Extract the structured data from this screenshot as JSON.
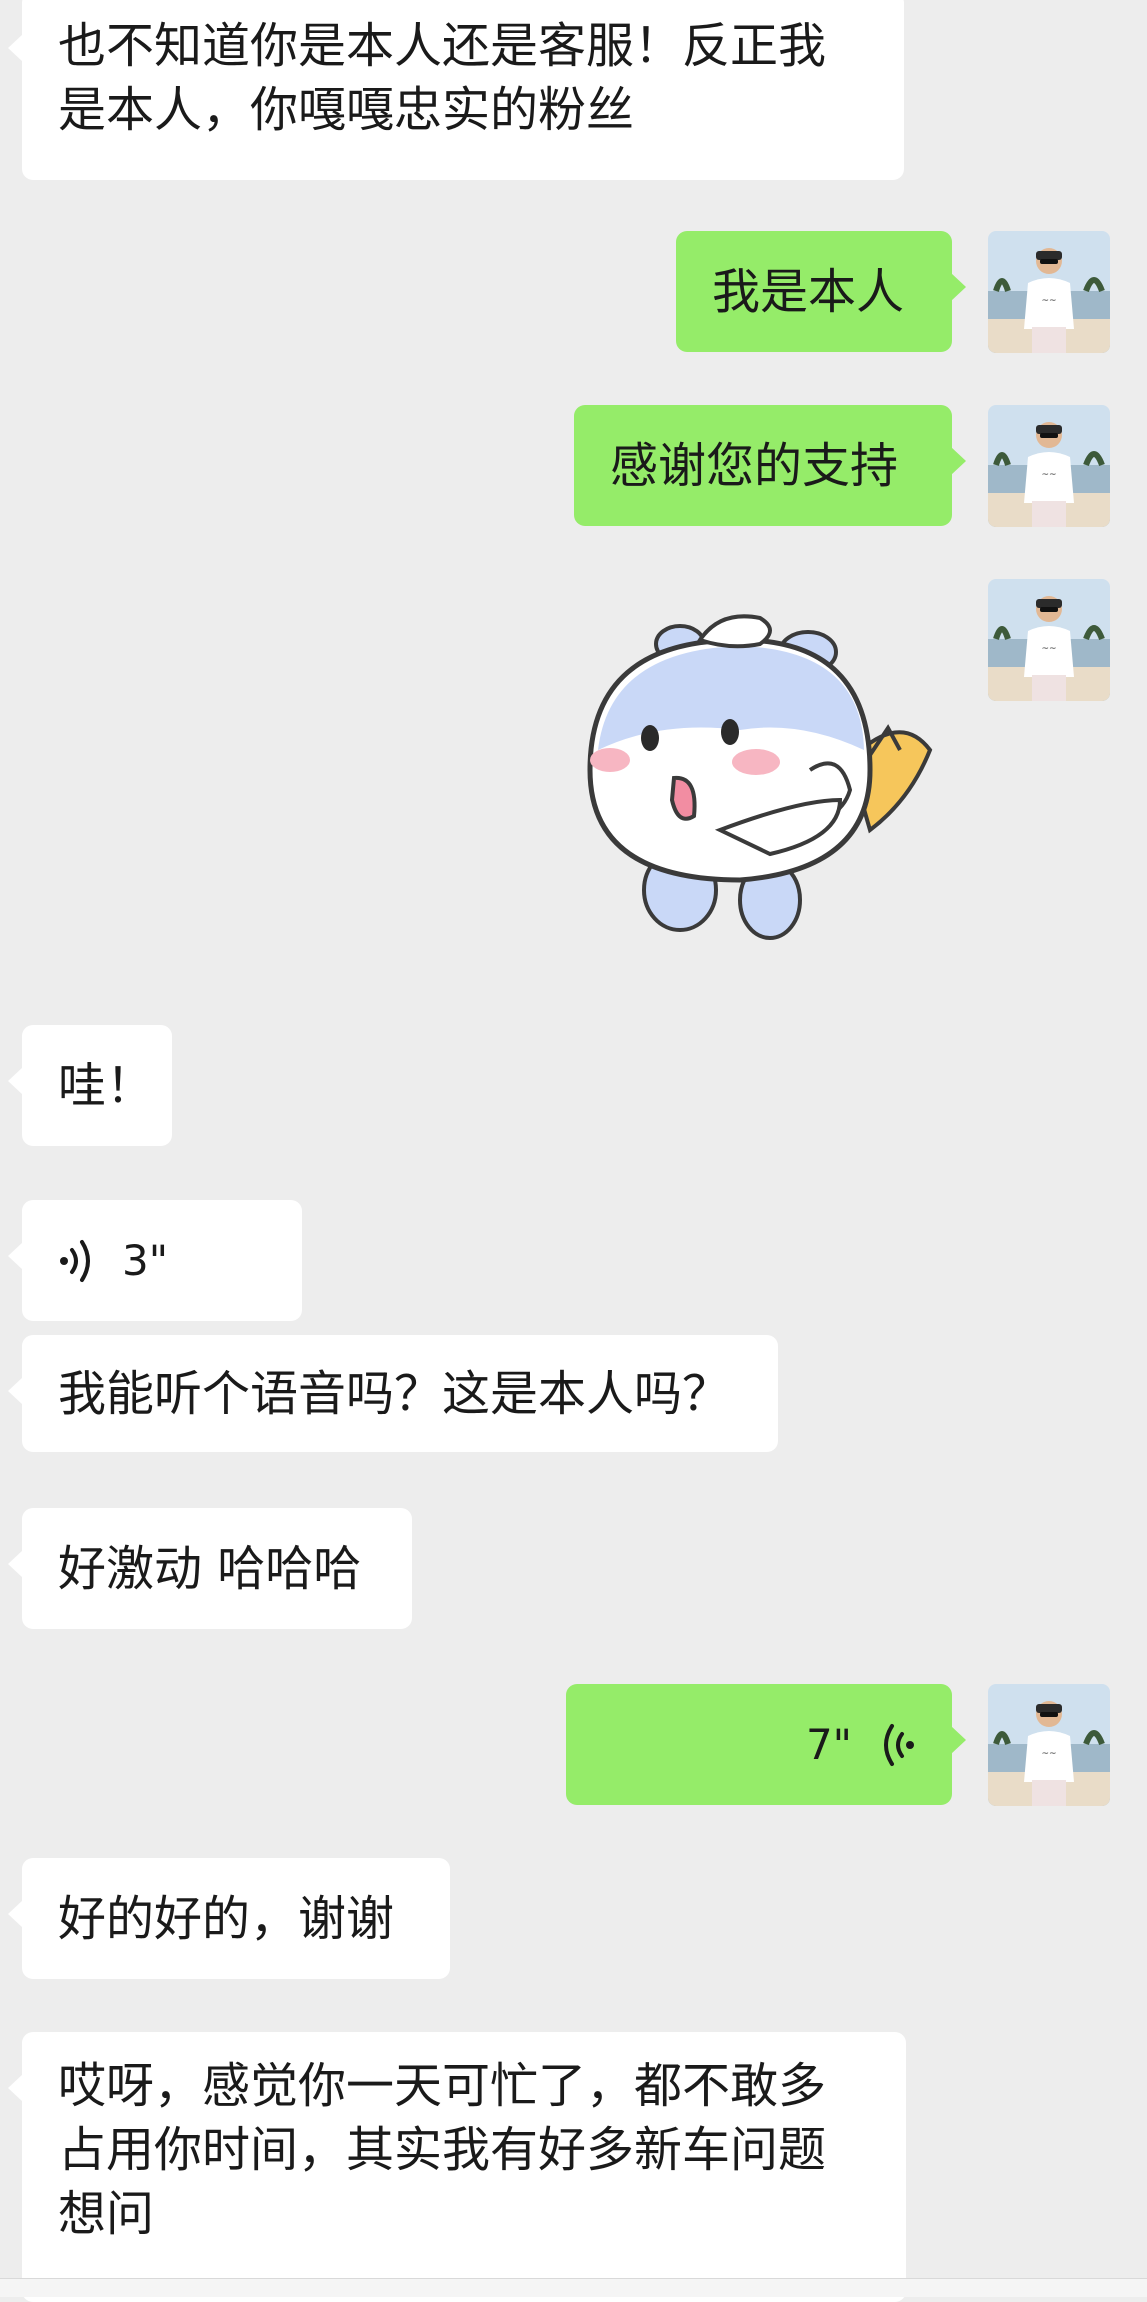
{
  "colors": {
    "background": "#ededed",
    "incoming_bubble": "#ffffff",
    "outgoing_bubble": "#95ec69",
    "text": "#1a1a1a"
  },
  "messages": [
    {
      "id": "m1",
      "direction": "incoming",
      "type": "text",
      "lines": [
        "也不知道你是本人还是客服！反正我",
        "是本人，你嘎嘎忠实的粉丝"
      ]
    },
    {
      "id": "m2",
      "direction": "outgoing",
      "type": "text",
      "lines": [
        "我是本人"
      ]
    },
    {
      "id": "m3",
      "direction": "outgoing",
      "type": "text",
      "lines": [
        "感谢您的支持"
      ]
    },
    {
      "id": "m4",
      "direction": "outgoing",
      "type": "sticker",
      "sticker_icon": "cute-cartoon-sticker"
    },
    {
      "id": "m5",
      "direction": "incoming",
      "type": "text",
      "lines": [
        "哇！"
      ]
    },
    {
      "id": "m6",
      "direction": "incoming",
      "type": "voice",
      "duration": "3\"",
      "icon": "voice-wave-icon"
    },
    {
      "id": "m7",
      "direction": "incoming",
      "type": "text",
      "lines": [
        "我能听个语音吗？这是本人吗？"
      ]
    },
    {
      "id": "m8",
      "direction": "incoming",
      "type": "text",
      "lines": [
        "好激动 哈哈哈"
      ]
    },
    {
      "id": "m9",
      "direction": "outgoing",
      "type": "voice",
      "duration": "7\"",
      "icon": "voice-wave-icon"
    },
    {
      "id": "m10",
      "direction": "incoming",
      "type": "text",
      "lines": [
        "好的好的，谢谢"
      ]
    },
    {
      "id": "m11",
      "direction": "incoming",
      "type": "text",
      "lines": [
        "哎呀，感觉你一天可忙了，都不敢多",
        "占用你时间，其实我有好多新车问题",
        "想问"
      ]
    }
  ],
  "self_avatar_icon": "user-avatar-photo"
}
